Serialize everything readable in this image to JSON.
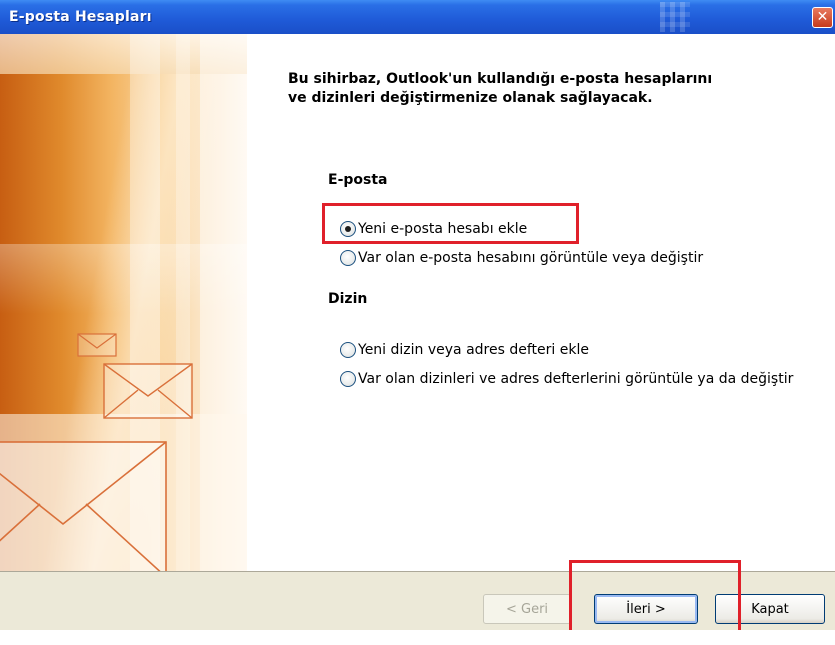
{
  "window": {
    "title": "E-posta Hesapları"
  },
  "intro": {
    "line1": "Bu sihirbaz, Outlook'un kullandığı e-posta hesaplarını",
    "line2": "ve dizinleri değiştirmenize olanak sağlayacak."
  },
  "email_section": {
    "label": "E-posta",
    "options": [
      {
        "label": "Yeni e-posta hesabı ekle",
        "selected": true
      },
      {
        "label": "Var olan e-posta hesabını görüntüle veya değiştir",
        "selected": false
      }
    ]
  },
  "directory_section": {
    "label": "Dizin",
    "options": [
      {
        "label": "Yeni dizin veya adres defteri ekle",
        "selected": false
      },
      {
        "label": "Var olan dizinleri ve adres defterlerini görüntüle ya da değiştir",
        "selected": false
      }
    ]
  },
  "buttons": {
    "back": "< Geri",
    "next": "İleri >",
    "close": "Kapat"
  },
  "icons": {
    "close": "close-icon",
    "envelope": "envelope-icon"
  },
  "colors": {
    "titlebar": "#1f5ad7",
    "highlight": "#e0202a",
    "art_orange": "#e08a2c",
    "footer": "#ece9d8"
  }
}
